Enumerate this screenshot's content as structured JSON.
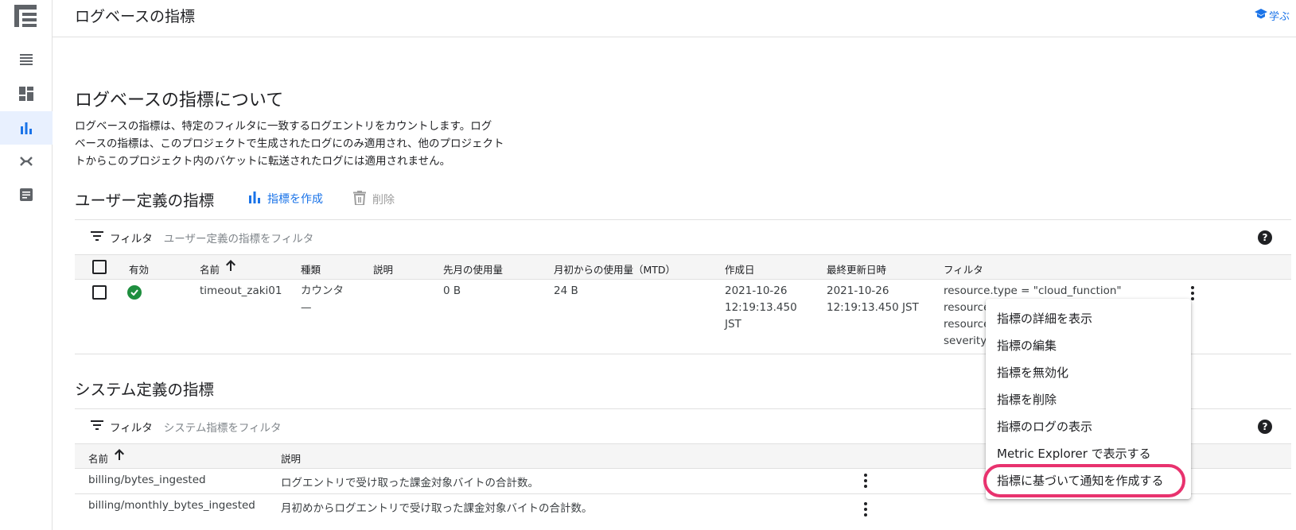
{
  "header": {
    "title": "ログベースの指標",
    "learn_label": "学ぶ"
  },
  "rail": {
    "logo_icon": "logging-logo-icon",
    "items": [
      {
        "icon": "logs-explorer-icon",
        "active": false
      },
      {
        "icon": "dashboard-icon",
        "active": false
      },
      {
        "icon": "bar-chart-icon",
        "active": true
      },
      {
        "icon": "router-icon",
        "active": false
      },
      {
        "icon": "document-icon",
        "active": false
      }
    ]
  },
  "about": {
    "title": "ログベースの指標について",
    "lines": [
      "ログベースの指標は、特定のフィルタに一致するログエントリをカウントします。ログ",
      "ベースの指標は、このプロジェクトで生成されたログにのみ適用され、他のプロジェクト",
      "トからこのプロジェクト内のバケットに転送されたログには適用されません。"
    ]
  },
  "user_defined": {
    "title": "ユーザー定義の指標",
    "create_label": "指標を作成",
    "delete_label": "削除",
    "filter_label": "フィルタ",
    "filter_placeholder": "ユーザー定義の指標をフィルタ",
    "columns": [
      "有効",
      "名前",
      "種類",
      "説明",
      "先月の使用量",
      "月初からの使用量（MTD）",
      "作成日",
      "最終更新日時",
      "フィルタ"
    ],
    "row": {
      "name": "timeout_zaki01",
      "type_line1": "カウンタ",
      "type_line2": "—",
      "description": "",
      "last_month": "0 B",
      "mtd": "24 B",
      "created_line1": "2021-10-26",
      "created_line2": "12:19:13.450",
      "created_line3": "JST",
      "updated_line1": "2021-10-26",
      "updated_line2": "12:19:13.450 JST",
      "filter_line1": "resource.type = \"cloud_function\"",
      "filter_line2": "resource",
      "filter_line3": "resource",
      "filter_line4": "severity>"
    }
  },
  "system_defined": {
    "title": "システム定義の指標",
    "filter_label": "フィルタ",
    "filter_placeholder": "システム指標をフィルタ",
    "columns": [
      "名前",
      "説明"
    ],
    "rows": [
      {
        "name": "billing/bytes_ingested",
        "description": "ログエントリで受け取った課金対象バイトの合計数。"
      },
      {
        "name": "billing/monthly_bytes_ingested",
        "description": "月初めからログエントリで受け取った課金対象バイトの合計数。"
      }
    ]
  },
  "menu": {
    "items": [
      "指標の詳細を表示",
      "指標の編集",
      "指標を無効化",
      "指標を削除",
      "指標のログの表示",
      "Metric Explorer で表示する",
      "指標に基づいて通知を作成する"
    ],
    "highlight_color": "#e8326e"
  },
  "colors": {
    "accent": "#1a73e8",
    "success": "#1e8e3e"
  }
}
